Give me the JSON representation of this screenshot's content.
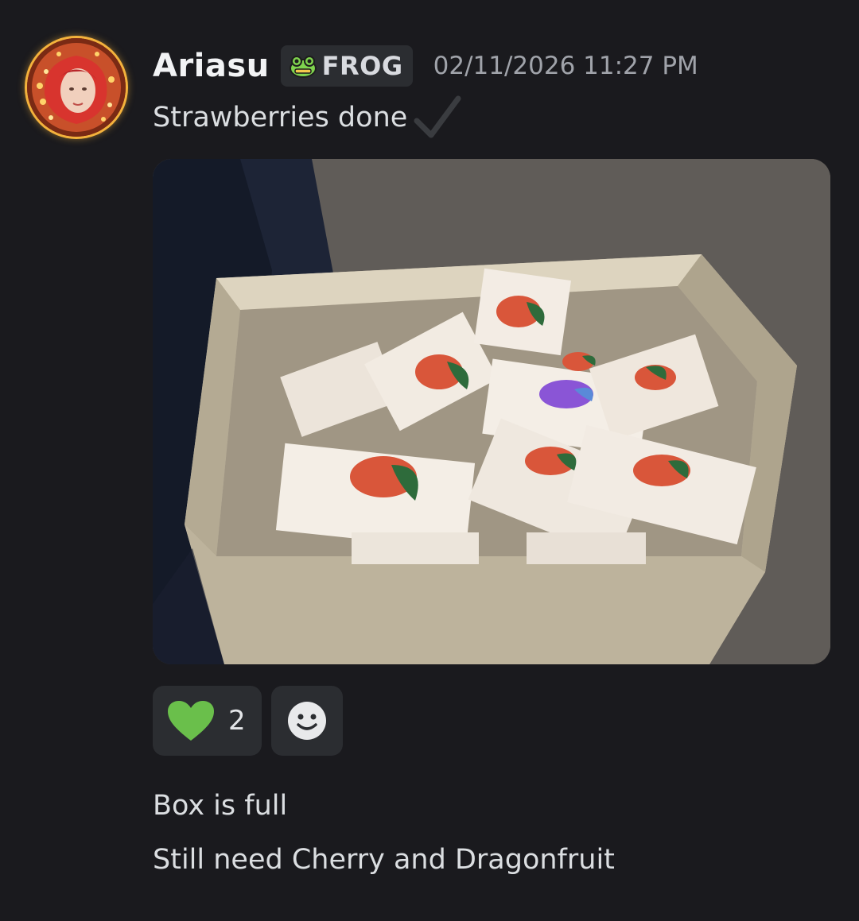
{
  "message": {
    "author": {
      "name": "Ariasu",
      "avatar": "avatar-red-hair-portrait",
      "tag": {
        "icon": "frog-icon",
        "label": "FROG"
      }
    },
    "timestamp": "02/11/2026 11:27 PM",
    "text": "Strawberries done",
    "text_emoji": "check-mark-icon",
    "attachment": {
      "type": "photo",
      "description_icon": "photo-of-box-of-pins"
    },
    "reactions": [
      {
        "emoji": "green-heart-icon",
        "count": "2"
      },
      {
        "emoji": "add-reaction-smile-icon"
      }
    ]
  },
  "follow_up": [
    {
      "text": "Box is full"
    },
    {
      "text": "Still need Cherry and Dragonfruit"
    }
  ],
  "colors": {
    "background": "#1a1a1e",
    "chip": "#2b2d31",
    "heart": "#6abf4b",
    "timestamp": "#a0a3aa"
  }
}
